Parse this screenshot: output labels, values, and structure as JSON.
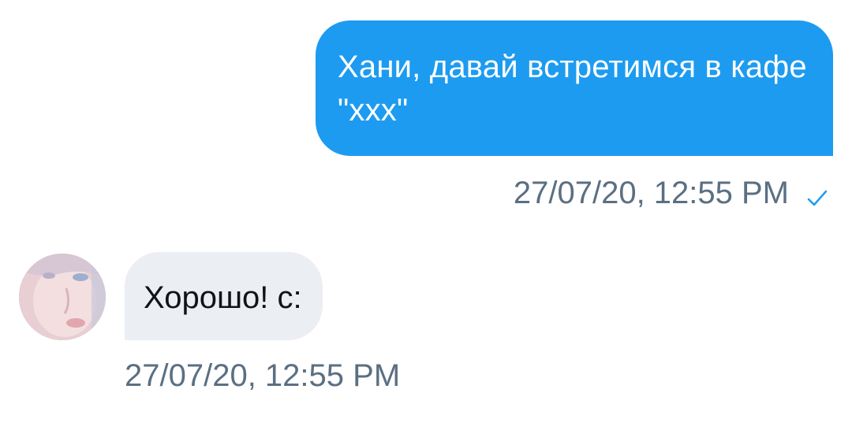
{
  "conversation": {
    "outgoing": {
      "text": "Хани, давай встретимся в кафе \"ххх\"",
      "timestamp": "27/07/20, 12:55 PM",
      "status_icon": "checkmark-icon",
      "bubble_color": "#1d9bf0"
    },
    "incoming": {
      "text": "Хорошо! с:",
      "timestamp": "27/07/20, 12:55 PM",
      "avatar_icon": "user-avatar",
      "bubble_color": "#ebeef3"
    }
  }
}
